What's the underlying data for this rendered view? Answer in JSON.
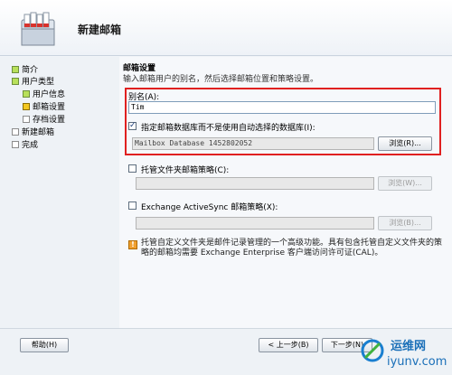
{
  "header": {
    "title": "新建邮箱"
  },
  "nav": {
    "items": [
      {
        "label": "简介",
        "state": "done"
      },
      {
        "label": "用户类型",
        "state": "done"
      },
      {
        "label": "用户信息",
        "state": "done"
      },
      {
        "label": "邮箱设置",
        "state": "current"
      },
      {
        "label": "存档设置",
        "state": "pending"
      },
      {
        "label": "新建邮箱",
        "state": "pending"
      },
      {
        "label": "完成",
        "state": "pending"
      }
    ]
  },
  "main": {
    "section_title": "邮箱设置",
    "section_desc": "输入邮箱用户的别名，然后选择邮箱位置和策略设置。",
    "alias": {
      "label": "别名(A):",
      "value": "Tim"
    },
    "db": {
      "checkbox_label": "指定邮箱数据库而不是使用自动选择的数据库(I):",
      "checked": true,
      "value": "Mailbox Database 1452802052",
      "browse": "浏览(R)..."
    },
    "managed_folder": {
      "checkbox_label": "托管文件夹邮箱策略(C):",
      "checked": false,
      "value": "",
      "browse": "浏览(W)..."
    },
    "activesync": {
      "checkbox_label": "Exchange ActiveSync 邮箱策略(X):",
      "checked": false,
      "value": "",
      "browse": "浏览(B)..."
    },
    "info_text": "托管自定义文件夹是邮件记录管理的一个高级功能。具有包含托管自定义文件夹的策略的邮箱均需要 Exchange Enterprise 客户端访问许可证(CAL)。"
  },
  "footer": {
    "help": "帮助(H)",
    "back": "< 上一步(B)",
    "next": "下一步(N)"
  },
  "watermark": {
    "text1": "运维网",
    "text2": "iyunv.com"
  },
  "colors": {
    "highlight_border": "#e02020",
    "accent": "#1c3d7a"
  }
}
